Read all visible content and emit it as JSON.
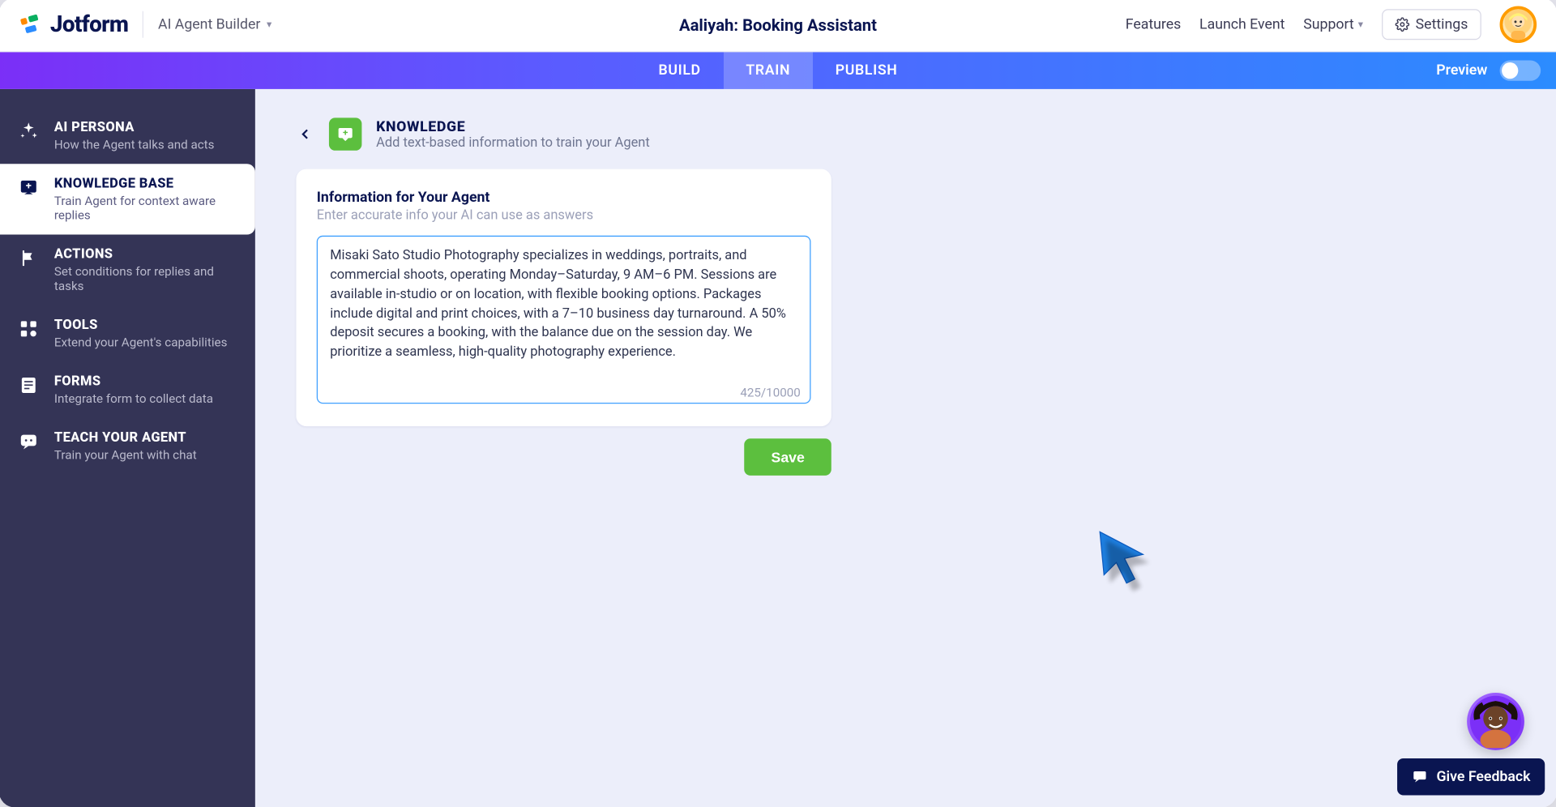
{
  "header": {
    "logo_text": "Jotform",
    "product": "AI Agent Builder",
    "page_title": "Aaliyah: Booking Assistant",
    "links": {
      "features": "Features",
      "launch": "Launch Event",
      "support": "Support",
      "settings": "Settings"
    }
  },
  "tabs": {
    "build": "BUILD",
    "train": "TRAIN",
    "publish": "PUBLISH",
    "preview": "Preview"
  },
  "sidebar": [
    {
      "title": "AI PERSONA",
      "sub": "How the Agent talks and acts"
    },
    {
      "title": "KNOWLEDGE BASE",
      "sub": "Train Agent for context aware replies"
    },
    {
      "title": "ACTIONS",
      "sub": "Set conditions for replies and tasks"
    },
    {
      "title": "TOOLS",
      "sub": "Extend your Agent's capabilities"
    },
    {
      "title": "FORMS",
      "sub": "Integrate form to collect data"
    },
    {
      "title": "TEACH YOUR AGENT",
      "sub": "Train your Agent with chat"
    }
  ],
  "knowledge": {
    "title": "KNOWLEDGE",
    "sub": "Add text-based information to train your Agent",
    "card_title": "Information for Your Agent",
    "card_sub": "Enter accurate info your AI can use as answers",
    "textarea_value": "Misaki Sato Studio Photography specializes in weddings, portraits, and commercial shoots, operating Monday–Saturday, 9 AM–6 PM. Sessions are available in-studio or on location, with flexible booking options. Packages include digital and print choices, with a 7–10 business day turnaround. A 50% deposit secures a booking, with the balance due on the session day. We prioritize a seamless, high-quality photography experience.",
    "counter": "425/10000",
    "save": "Save"
  },
  "feedback": "Give Feedback"
}
